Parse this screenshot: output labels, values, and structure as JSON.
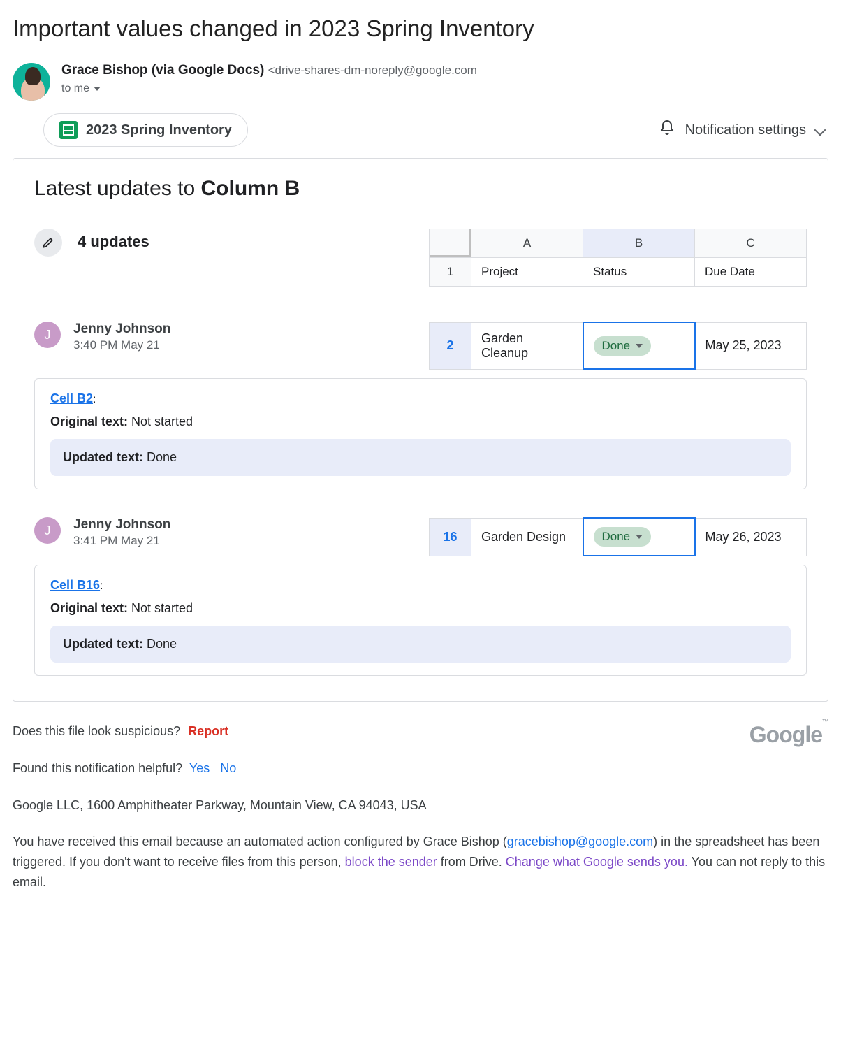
{
  "subject": "Important values changed in 2023 Spring Inventory",
  "sender": {
    "name": "Grace Bishop (via Google Docs)",
    "email": "<drive-shares-dm-noreply@google.com",
    "to": "to me"
  },
  "doc_chip": {
    "label": "2023 Spring Inventory"
  },
  "notif_settings": "Notification settings",
  "card": {
    "title_prefix": "Latest updates to ",
    "title_bold": "Column B",
    "updates_count": "4 updates",
    "header_cols": {
      "a": "A",
      "b": "B",
      "c": "C",
      "row": "1"
    },
    "header_cells": {
      "a": "Project",
      "b": "Status",
      "c": "Due Date"
    }
  },
  "updates": [
    {
      "initial": "J",
      "name": "Jenny Johnson",
      "time": "3:40 PM May 21",
      "row_num": "2",
      "cells": {
        "a": "Garden Cleanup",
        "b_pill": "Done",
        "c": "May 25, 2023"
      },
      "cell_link": "Cell B2",
      "original_label": "Original text: ",
      "original_value": "Not started",
      "updated_label": "Updated text: ",
      "updated_value": "Done"
    },
    {
      "initial": "J",
      "name": "Jenny Johnson",
      "time": "3:41 PM May 21",
      "row_num": "16",
      "cells": {
        "a": "Garden Design",
        "b_pill": "Done",
        "c": "May 26, 2023"
      },
      "cell_link": "Cell B16",
      "original_label": "Original text: ",
      "original_value": "Not started",
      "updated_label": "Updated text: ",
      "updated_value": "Done"
    }
  ],
  "footer": {
    "suspicious_q": "Does this file look suspicious?",
    "report": "Report",
    "helpful_q": "Found this notification helpful?",
    "yes": "Yes",
    "no": "No",
    "address": "Google LLC, 1600 Amphitheater Parkway, Mountain View, CA 94043, USA",
    "reason_1": "You have received this email because an automated action configured by Grace Bishop (",
    "reason_email": "gracebishop@google.com",
    "reason_2": ") in the spreadsheet has been triggered. If you don't want to receive files from this person, ",
    "block_sender": "block the sender",
    "reason_3": " from Drive. ",
    "change_link": "Change what Google sends you.",
    "reason_4": " You can not reply to this email.",
    "google": "Google",
    "tm": "™"
  }
}
